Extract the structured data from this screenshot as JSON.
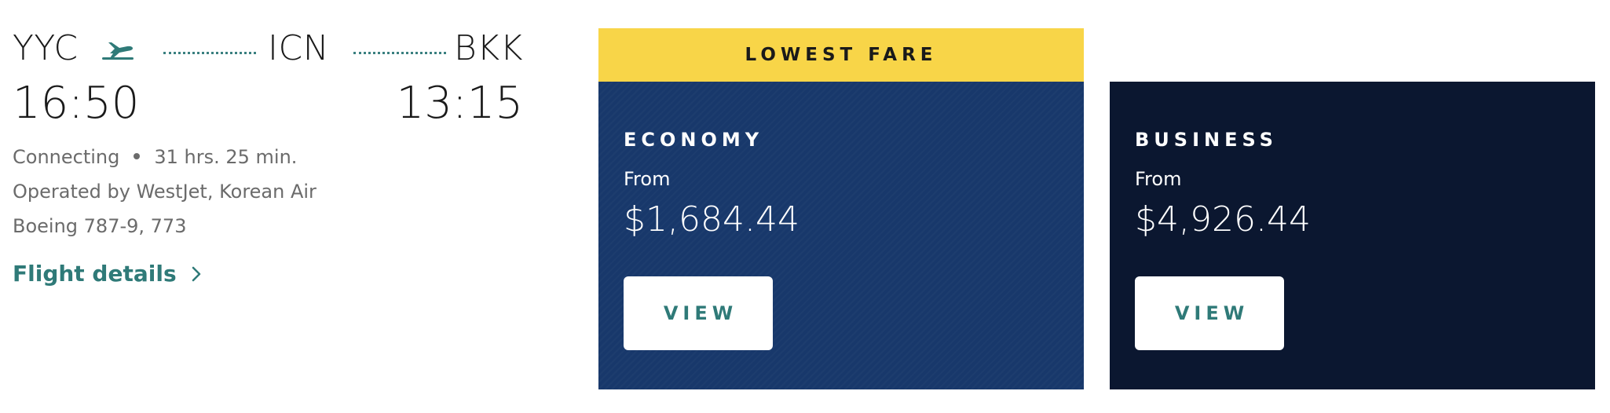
{
  "flight": {
    "origin": "YYC",
    "stop": "ICN",
    "destination": "BKK",
    "departure_time": "16:50",
    "arrival_time": "13:15",
    "connection_type": "Connecting",
    "duration": "31 hrs. 25 min.",
    "operated_by": "Operated by WestJet, Korean Air",
    "aircraft": "Boeing 787-9, 773",
    "details_link": "Flight details"
  },
  "fares": {
    "banner": "LOWEST FARE",
    "economy": {
      "cabin": "ECONOMY",
      "from_label": "From",
      "price": "$1,684.44",
      "button": "VIEW"
    },
    "business": {
      "cabin": "BUSINESS",
      "from_label": "From",
      "price": "$4,926.44",
      "button": "VIEW"
    }
  },
  "icons": {
    "plane": "airplane-takeoff-icon",
    "chevron": "chevron-right-icon"
  },
  "colors": {
    "accent_teal": "#2f7a78",
    "banner_yellow": "#f8d548",
    "economy_bg": "#18386b",
    "business_bg": "#0b1730"
  }
}
